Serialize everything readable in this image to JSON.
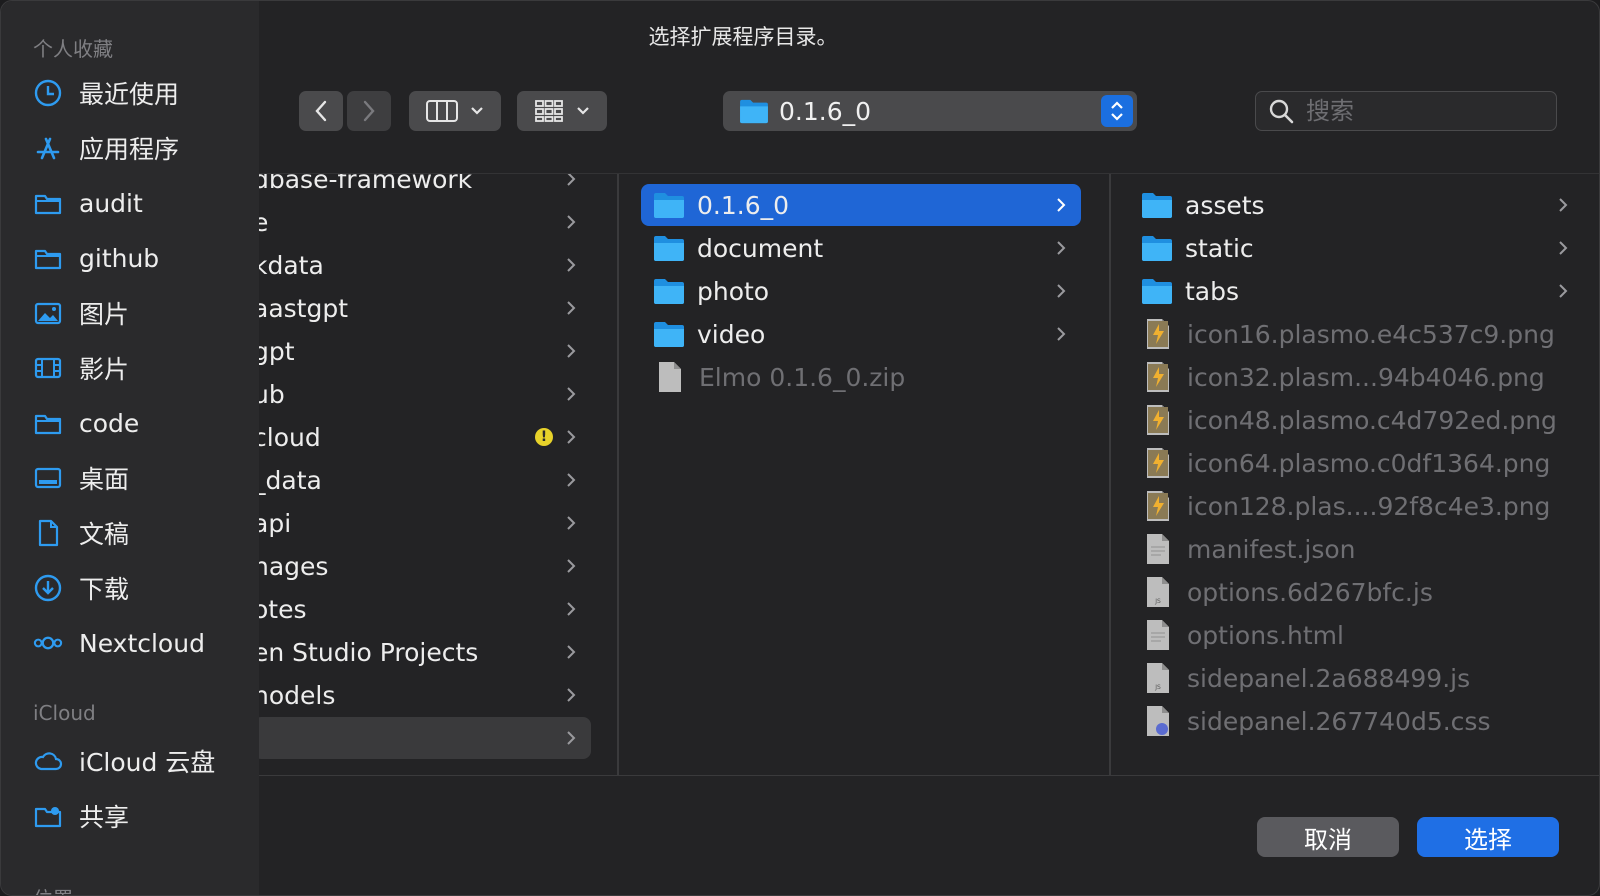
{
  "dialog": {
    "title": "选择扩展程序目录。"
  },
  "sidebar": {
    "favorites_header": "个人收藏",
    "favorites": [
      {
        "label": "最近使用",
        "icon": "clock-icon"
      },
      {
        "label": "应用程序",
        "icon": "app-store-icon"
      },
      {
        "label": "audit",
        "icon": "folder-icon"
      },
      {
        "label": "github",
        "icon": "folder-icon"
      },
      {
        "label": "图片",
        "icon": "photo-icon"
      },
      {
        "label": "影片",
        "icon": "film-icon"
      },
      {
        "label": "code",
        "icon": "folder-icon"
      },
      {
        "label": "桌面",
        "icon": "desktop-icon"
      },
      {
        "label": "文稿",
        "icon": "document-icon"
      },
      {
        "label": "下载",
        "icon": "download-icon"
      },
      {
        "label": "Nextcloud",
        "icon": "nextcloud-icon"
      }
    ],
    "icloud_header": "iCloud",
    "icloud": [
      {
        "label": "iCloud 云盘",
        "icon": "cloud-icon"
      },
      {
        "label": "共享",
        "icon": "shared-folder-icon"
      }
    ],
    "locations_header": "位置"
  },
  "toolbar": {
    "path": "0.1.6_0",
    "search_placeholder": "搜索",
    "view_mode": "columns-icon",
    "group_mode": "grid-icon"
  },
  "columns": {
    "col1": [
      "dbase-framework",
      "e",
      "kdata",
      "aastgpt",
      "gpt",
      "ub",
      "cloud",
      "_data",
      "api",
      "nages",
      "otes",
      "en Studio Projects",
      "nodels",
      ""
    ],
    "col2": [
      {
        "name": "0.1.6_0",
        "type": "folder",
        "selected": true
      },
      {
        "name": "document",
        "type": "folder"
      },
      {
        "name": "photo",
        "type": "folder"
      },
      {
        "name": "video",
        "type": "folder"
      },
      {
        "name": "Elmo 0.1.6_0.zip",
        "type": "file"
      }
    ],
    "col3": [
      {
        "name": "assets",
        "type": "folder"
      },
      {
        "name": "static",
        "type": "folder"
      },
      {
        "name": "tabs",
        "type": "folder"
      },
      {
        "name": "icon16.plasmo.e4c537c9.png",
        "type": "image"
      },
      {
        "name": "icon32.plasm...94b4046.png",
        "type": "image"
      },
      {
        "name": "icon48.plasmo.c4d792ed.png",
        "type": "image"
      },
      {
        "name": "icon64.plasmo.c0df1364.png",
        "type": "image"
      },
      {
        "name": "icon128.plas....92f8c4e3.png",
        "type": "image"
      },
      {
        "name": "manifest.json",
        "type": "file"
      },
      {
        "name": "options.6d267bfc.js",
        "type": "js"
      },
      {
        "name": "options.html",
        "type": "file"
      },
      {
        "name": "sidepanel.2a688499.js",
        "type": "js"
      },
      {
        "name": "sidepanel.267740d5.css",
        "type": "css"
      }
    ]
  },
  "buttons": {
    "cancel": "取消",
    "choose": "选择"
  },
  "colors": {
    "accent": "#1f6fe5",
    "selection": "#1f66d6",
    "folder": "#2aa6f2"
  }
}
